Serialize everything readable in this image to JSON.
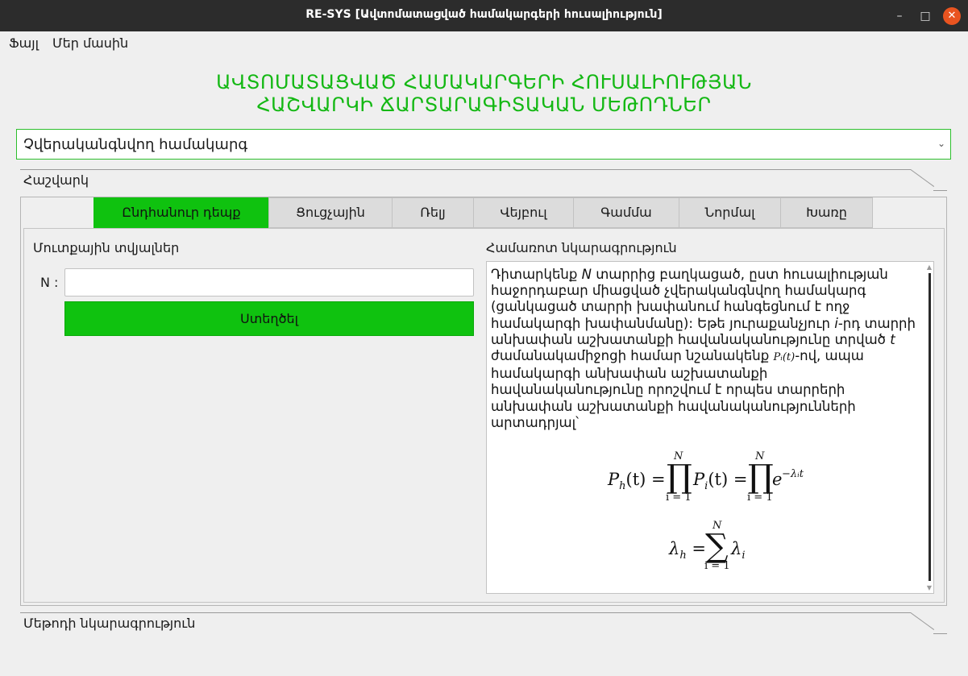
{
  "window": {
    "title": "RE-SYS [Ավտոմատացված համակարգերի հուսալիություն]",
    "minimize_glyph": "–",
    "maximize_glyph": "□",
    "close_glyph": "✕"
  },
  "menu": [
    "Ֆայլ",
    "Մեր մասին"
  ],
  "heading": {
    "line1": "ԱՎՏՈՄԱՏԱՑՎԱԾ ՀԱՄԱԿԱՐԳԵՐԻ ՀՈՒՍԱԼԻՈՒԹՅԱՆ",
    "line2": "ՀԱՇՎԱՐԿԻ ՃԱՐՏԱՐԱԳԻՏԱԿԱՆ ՄԵԹՈԴՆԵՐ"
  },
  "system_select": {
    "selected": "Չվերականգնվող համակարգ",
    "chevron": "⌄"
  },
  "calc_group": {
    "label": "Հաշվարկ"
  },
  "tabs": [
    "Ընդհանուր դեպք",
    "Ցուցչային",
    "Ռելյ",
    "Վեյբուլ",
    "Գամմա",
    "Նորմալ",
    "Խառը"
  ],
  "active_tab": 0,
  "input_section": {
    "label": "Մուտքային տվյալներ",
    "n_label": "N :",
    "n_value": "",
    "create_button": "Ստեղծել"
  },
  "summary_section": {
    "label": "Համառոտ նկարագրություն",
    "text": {
      "p1": "Դիտարկենք ",
      "N": "N",
      "p2": " տարրից բաղկացած, ըստ հուսալիության հաջորդաբար միացված չվերականգնվող համակարգ (ցանկացած տարրի խափանում հանգեցնում է ողջ համակարգի խափանմանը): Եթե յուրաքանչյուր ",
      "i": "i",
      "p3": "-րդ տարրի անխափան աշխատանքի հավանականությունը տրված ",
      "t": "t",
      "p4": " ժամանակամիջոցի համար նշանակենք ",
      "pit": "Pᵢ(t)",
      "p5": "-ով, ապա համակարգի անխափան աշխատանքի հավանականությունը որոշվում է որպես տարրերի անխափան աշխատանքի հավանականությունների արտադրյալ՝"
    },
    "formula1": {
      "lhs": "P",
      "lhs_sub": "h",
      "lhs_arg": "(t) =",
      "prod": "∏",
      "upper": "N",
      "lower": "i = 1",
      "mid": "P",
      "mid_sub": "i",
      "mid_arg": "(t) =",
      "rhs": "e",
      "rhs_exp": "−λᵢt"
    },
    "formula2": {
      "lhs": "λ",
      "lhs_sub": "h",
      "eq": "=",
      "sum": "∑",
      "upper": "N",
      "lower": "i = 1",
      "rhs": "λ",
      "rhs_sub": "i"
    },
    "scroll_up": "▲",
    "scroll_down": "▼"
  },
  "method_group": {
    "label": "Մեթոդի նկարագրություն"
  }
}
